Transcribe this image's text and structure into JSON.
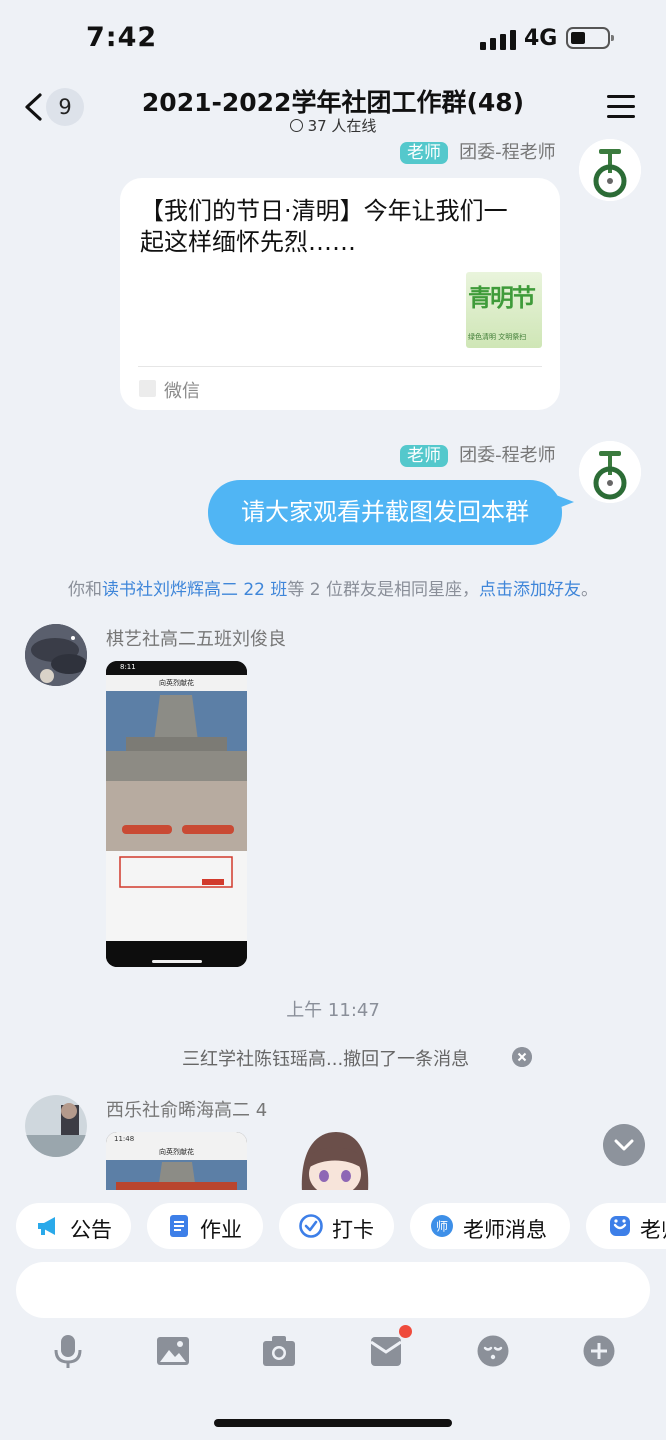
{
  "status_bar": {
    "time": "7:42",
    "network": "4G"
  },
  "header": {
    "back_count": "9",
    "title": "2021-2022学年社团工作群(48)",
    "online": "37 人在线"
  },
  "messages": {
    "teacher_tag": "老师",
    "teacher_name": "团委-程老师",
    "card": {
      "text": "【我们的节日·清明】今年让我们一起这样缅怀先烈……",
      "thumb_big": "青明节",
      "thumb_small": "绿色清明  文明祭扫",
      "source": "微信"
    },
    "bubble_text": "请大家观看并截图发回本群",
    "system_notice": {
      "prefix": "你和",
      "link_name": "读书社刘烨辉高二 22 班",
      "middle": "等 2 位群友是相同星座，",
      "link_action": "点击添加好友",
      "suffix": "。"
    },
    "user1_name": "棋艺社高二五班刘俊良",
    "screenshot": {
      "time": "8:11",
      "title": "向英烈献花"
    },
    "timestamp": "上午 11:47",
    "recall_notice": "三红学社陈钰瑶高...撤回了一条消息",
    "user2_name": "西乐社俞晞海高二 4",
    "screenshot2": {
      "time": "11:48",
      "title": "向英烈献花"
    }
  },
  "quick_tools": [
    {
      "label": "公告",
      "icon": "megaphone-icon"
    },
    {
      "label": "作业",
      "icon": "document-icon"
    },
    {
      "label": "打卡",
      "icon": "checkin-icon"
    },
    {
      "label": "老师消息",
      "icon": "teacher-message-icon"
    },
    {
      "label": "老师",
      "icon": "teacher-icon"
    }
  ],
  "input": {
    "placeholder": ""
  },
  "colors": {
    "accent_blue": "#50b5f4",
    "teacher_tag": "#54c8cc",
    "link": "#3f86d9",
    "badge_dot": "#ef4b3c"
  }
}
